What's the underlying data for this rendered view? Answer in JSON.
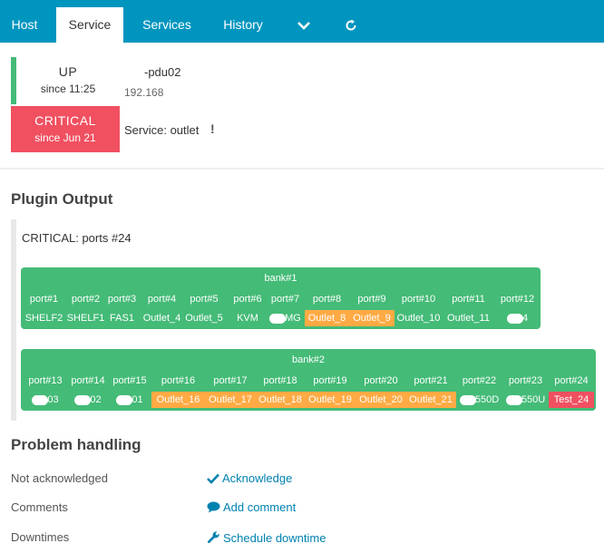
{
  "nav": {
    "tabs": [
      "Host",
      "Service",
      "Services",
      "History"
    ],
    "active": "Service"
  },
  "host": {
    "state": "UP",
    "since": "since 11:25",
    "name": "-pdu02",
    "address": "192.168"
  },
  "service": {
    "state": "CRITICAL",
    "since": "since Jun 21",
    "label": "Service: outlet",
    "warn_glyph": "!"
  },
  "plugin_output": {
    "heading": "Plugin Output",
    "line": "CRITICAL: ports #24",
    "banks": [
      {
        "title": "bank#1",
        "ports": [
          "port#1",
          "port#2",
          "port#3",
          "port#4",
          "port#5",
          "port#6",
          "port#7",
          "port#8",
          "port#9",
          "port#10",
          "port#11",
          "port#12"
        ],
        "outlets": [
          {
            "prefix": "",
            "text": "SHELF2",
            "status": "ok"
          },
          {
            "prefix": "",
            "text": "SHELF1",
            "status": "ok"
          },
          {
            "prefix": "",
            "text": "FAS1",
            "status": "ok"
          },
          {
            "prefix": "",
            "text": "Outlet_4",
            "status": "ok"
          },
          {
            "prefix": "",
            "text": "Outlet_5",
            "status": "ok"
          },
          {
            "prefix": "",
            "text": "KVM",
            "status": "ok"
          },
          {
            "prefix": "redacted",
            "text": "MG",
            "status": "ok"
          },
          {
            "prefix": "",
            "text": "Outlet_8",
            "status": "warning"
          },
          {
            "prefix": "",
            "text": "Outlet_9",
            "status": "warning"
          },
          {
            "prefix": "",
            "text": "Outlet_10",
            "status": "ok"
          },
          {
            "prefix": "",
            "text": "Outlet_11",
            "status": "ok"
          },
          {
            "prefix": "redacted",
            "text": "4",
            "status": "ok"
          }
        ]
      },
      {
        "title": "bank#2",
        "ports": [
          "port#13",
          "port#14",
          "port#15",
          "port#16",
          "port#17",
          "port#18",
          "port#19",
          "port#20",
          "port#21",
          "port#22",
          "port#23",
          "port#24"
        ],
        "outlets": [
          {
            "prefix": "redacted",
            "text": "03",
            "status": "ok"
          },
          {
            "prefix": "redacted",
            "text": "02",
            "status": "ok"
          },
          {
            "prefix": "redacted",
            "text": "01",
            "status": "ok"
          },
          {
            "prefix": "",
            "text": "Outlet_16",
            "status": "warning"
          },
          {
            "prefix": "",
            "text": "Outlet_17",
            "status": "warning"
          },
          {
            "prefix": "",
            "text": "Outlet_18",
            "status": "warning"
          },
          {
            "prefix": "",
            "text": "Outlet_19",
            "status": "warning"
          },
          {
            "prefix": "",
            "text": "Outlet_20",
            "status": "warning"
          },
          {
            "prefix": "",
            "text": "Outlet_21",
            "status": "warning"
          },
          {
            "prefix": "redacted",
            "text": "550D",
            "status": "ok"
          },
          {
            "prefix": "redacted",
            "text": "550U",
            "status": "ok"
          },
          {
            "prefix": "",
            "text": "Test_24",
            "status": "critical"
          }
        ]
      }
    ]
  },
  "problem_handling": {
    "heading": "Problem handling",
    "rows": [
      {
        "label": "Not acknowledged",
        "action": "Acknowledge",
        "icon": "check-icon"
      },
      {
        "label": "Comments",
        "action": "Add comment",
        "icon": "comment-icon"
      },
      {
        "label": "Downtimes",
        "action": "Schedule downtime",
        "icon": "wrench-icon"
      }
    ]
  },
  "colors": {
    "nav": "#0095bf",
    "ok": "#44bb77",
    "warning": "#ffaa44",
    "critical": "#f05060",
    "link": "#0082b0"
  }
}
